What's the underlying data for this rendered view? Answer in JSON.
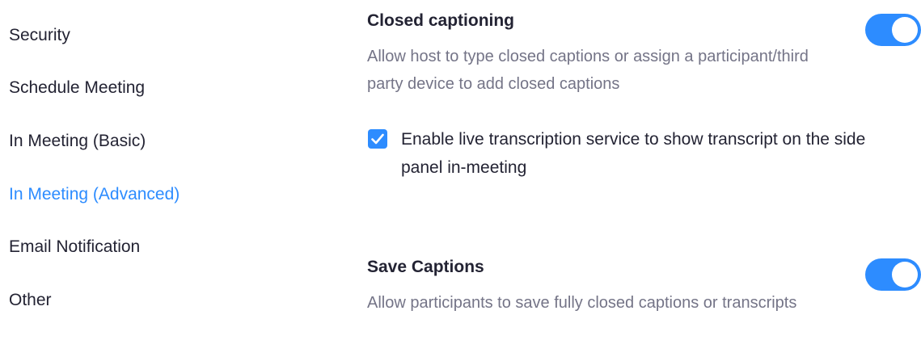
{
  "sidebar": {
    "items": [
      {
        "label": "Security",
        "active": false
      },
      {
        "label": "Schedule Meeting",
        "active": false
      },
      {
        "label": "In Meeting (Basic)",
        "active": false
      },
      {
        "label": "In Meeting (Advanced)",
        "active": true
      },
      {
        "label": "Email Notification",
        "active": false
      },
      {
        "label": "Other",
        "active": false
      }
    ]
  },
  "settings": {
    "closed_captioning": {
      "title": "Closed captioning",
      "description": "Allow host to type closed captions or assign a participant/third party device to add closed captions",
      "enabled": true,
      "live_transcription": {
        "label": "Enable live transcription service to show transcript on the side panel in-meeting",
        "checked": true
      }
    },
    "save_captions": {
      "title": "Save Captions",
      "description": "Allow participants to save fully closed captions or transcripts",
      "enabled": true
    }
  },
  "colors": {
    "accent": "#2d8cff",
    "text_primary": "#232333",
    "text_secondary": "#747487"
  },
  "icons": {
    "toggle": "toggle-switch-on",
    "checkbox": "checkmark-icon"
  }
}
